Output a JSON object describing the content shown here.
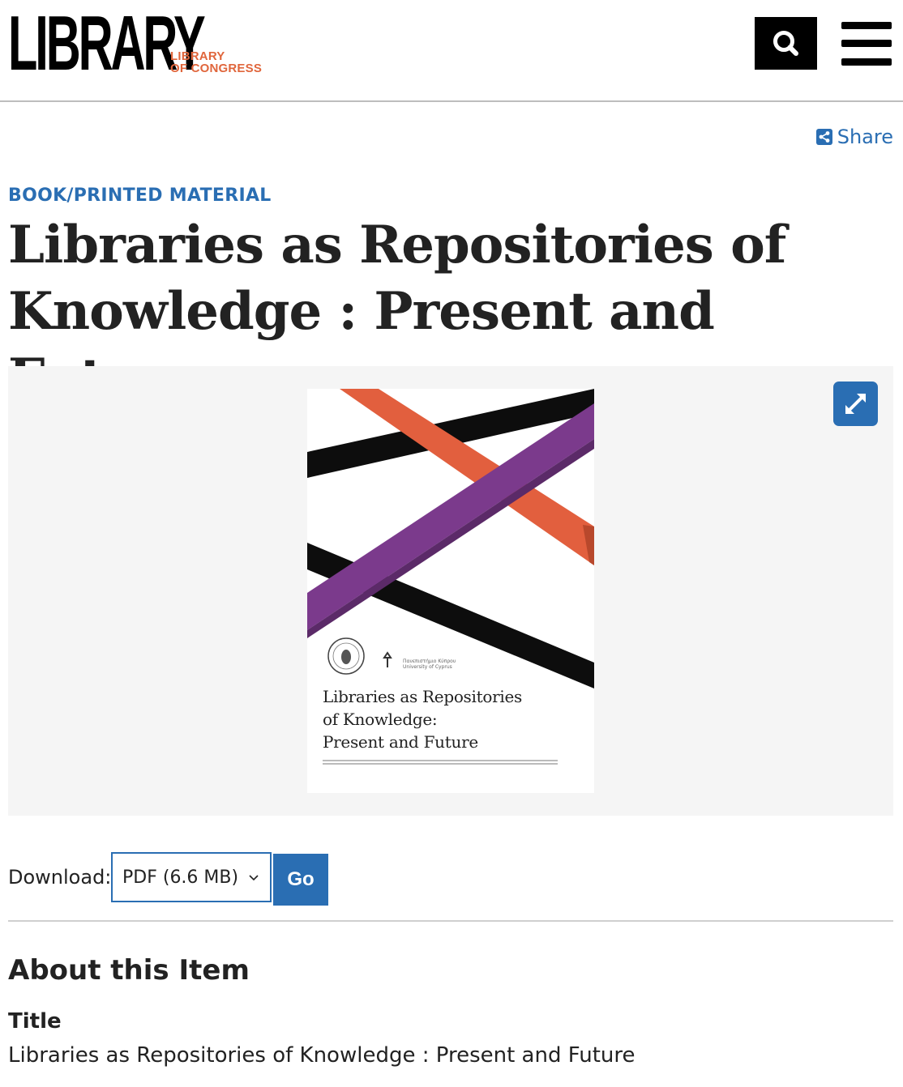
{
  "header": {
    "logo_word": "LIBRARY",
    "logo_sub_line1": "LIBRARY",
    "logo_sub_line2": "OF CONGRESS",
    "search_icon": "search-icon",
    "menu_icon": "hamburger-menu-icon"
  },
  "share": {
    "label": "Share",
    "icon": "share-icon"
  },
  "item": {
    "category": "BOOK/PRINTED MATERIAL",
    "title": "Libraries as Repositories of Knowledge : Present and Future"
  },
  "viewer": {
    "expand_icon": "expand-icon",
    "cover": {
      "title_line1": "Libraries as Repositories",
      "title_line2": "of Knowledge:",
      "title_line3": "Present and Future",
      "university": "Πανεπιστήμιο Κύπρου\nUniversity of Cyprus",
      "colors": {
        "orange": "#e25f3e",
        "purple": "#7b3a8c",
        "black": "#0d0d0d"
      }
    }
  },
  "download": {
    "label": "Download:",
    "selected_option": "PDF (6.6 MB)",
    "go_label": "Go"
  },
  "about": {
    "heading": "About this Item",
    "fields": [
      {
        "label": "Title",
        "value": "Libraries as Repositories of Knowledge : Present and Future"
      }
    ]
  },
  "colors": {
    "accent": "#2a6eb3",
    "brand_orange": "#e0663c"
  }
}
